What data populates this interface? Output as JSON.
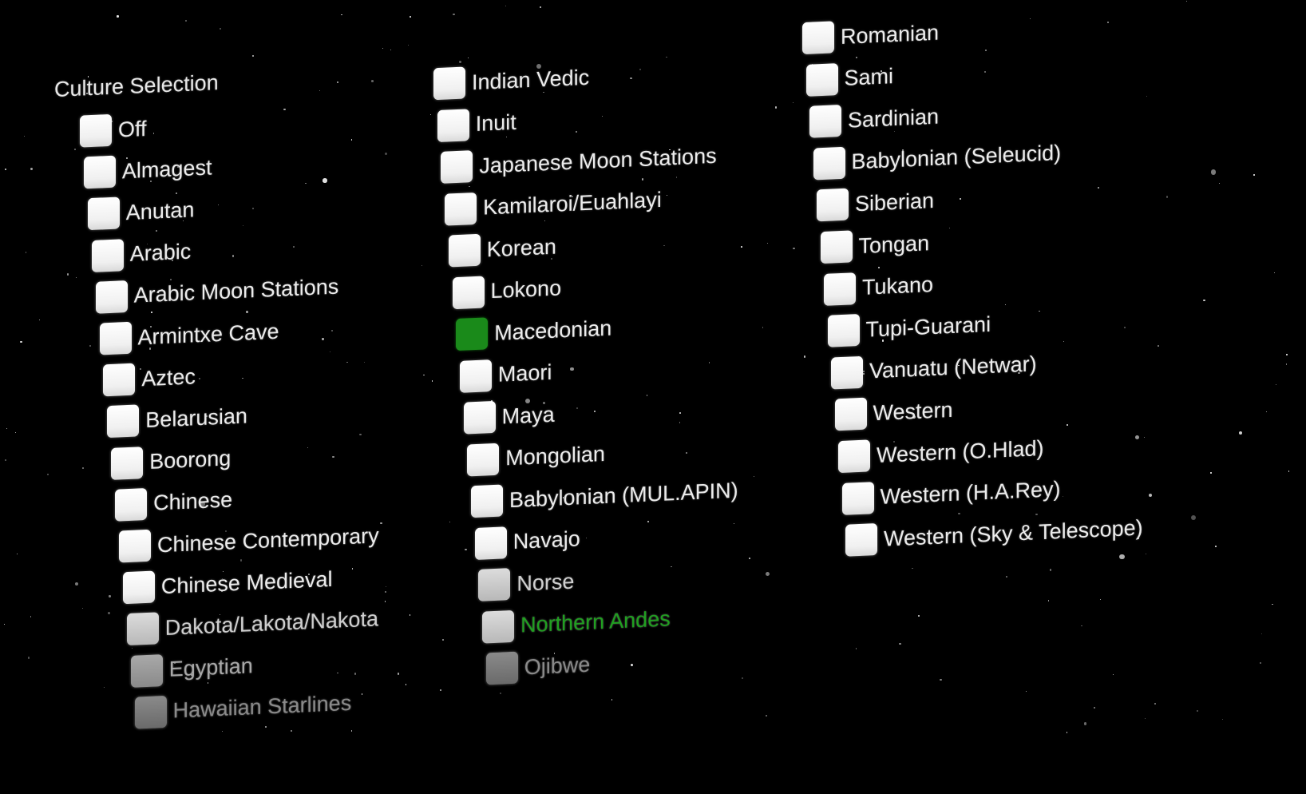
{
  "panel": {
    "title": "Culture Selection",
    "selected_color": "#1a8a1a",
    "columns": [
      [
        {
          "label": "Off",
          "checked": false
        },
        {
          "label": "Almagest",
          "checked": false
        },
        {
          "label": "Anutan",
          "checked": false
        },
        {
          "label": "Arabic",
          "checked": false
        },
        {
          "label": "Arabic Moon Stations",
          "checked": false
        },
        {
          "label": "Armintxe Cave",
          "checked": false
        },
        {
          "label": "Aztec",
          "checked": false
        },
        {
          "label": "Belarusian",
          "checked": false
        },
        {
          "label": "Boorong",
          "checked": false
        },
        {
          "label": "Chinese",
          "checked": false
        },
        {
          "label": "Chinese Contemporary",
          "checked": false
        },
        {
          "label": "Chinese Medieval",
          "checked": false
        },
        {
          "label": "Dakota/Lakota/Nakota",
          "checked": false
        },
        {
          "label": "Egyptian",
          "checked": false
        },
        {
          "label": "Hawaiian Starlines",
          "checked": false
        }
      ],
      [
        {
          "label": "Indian Vedic",
          "checked": false
        },
        {
          "label": "Inuit",
          "checked": false
        },
        {
          "label": "Japanese Moon Stations",
          "checked": false
        },
        {
          "label": "Kamilaroi/Euahlayi",
          "checked": false
        },
        {
          "label": "Korean",
          "checked": false
        },
        {
          "label": "Lokono",
          "checked": false
        },
        {
          "label": "Macedonian",
          "checked": true
        },
        {
          "label": "Maori",
          "checked": false
        },
        {
          "label": "Maya",
          "checked": false
        },
        {
          "label": "Mongolian",
          "checked": false
        },
        {
          "label": "Babylonian (MUL.APIN)",
          "checked": false
        },
        {
          "label": "Navajo",
          "checked": false
        },
        {
          "label": "Norse",
          "checked": false
        },
        {
          "label": "Northern Andes",
          "checked": false,
          "highlighted": true
        },
        {
          "label": "Ojibwe",
          "checked": false
        }
      ],
      [
        {
          "label": "Romanian",
          "checked": false
        },
        {
          "label": "Sami",
          "checked": false
        },
        {
          "label": "Sardinian",
          "checked": false
        },
        {
          "label": "Babylonian (Seleucid)",
          "checked": false
        },
        {
          "label": "Siberian",
          "checked": false
        },
        {
          "label": "Tongan",
          "checked": false
        },
        {
          "label": "Tukano",
          "checked": false
        },
        {
          "label": "Tupi-Guarani",
          "checked": false
        },
        {
          "label": "Vanuatu (Netwar)",
          "checked": false
        },
        {
          "label": "Western",
          "checked": false
        },
        {
          "label": "Western (O.Hlad)",
          "checked": false
        },
        {
          "label": "Western (H.A.Rey)",
          "checked": false
        },
        {
          "label": "Western (Sky & Telescope)",
          "checked": false
        }
      ]
    ]
  }
}
